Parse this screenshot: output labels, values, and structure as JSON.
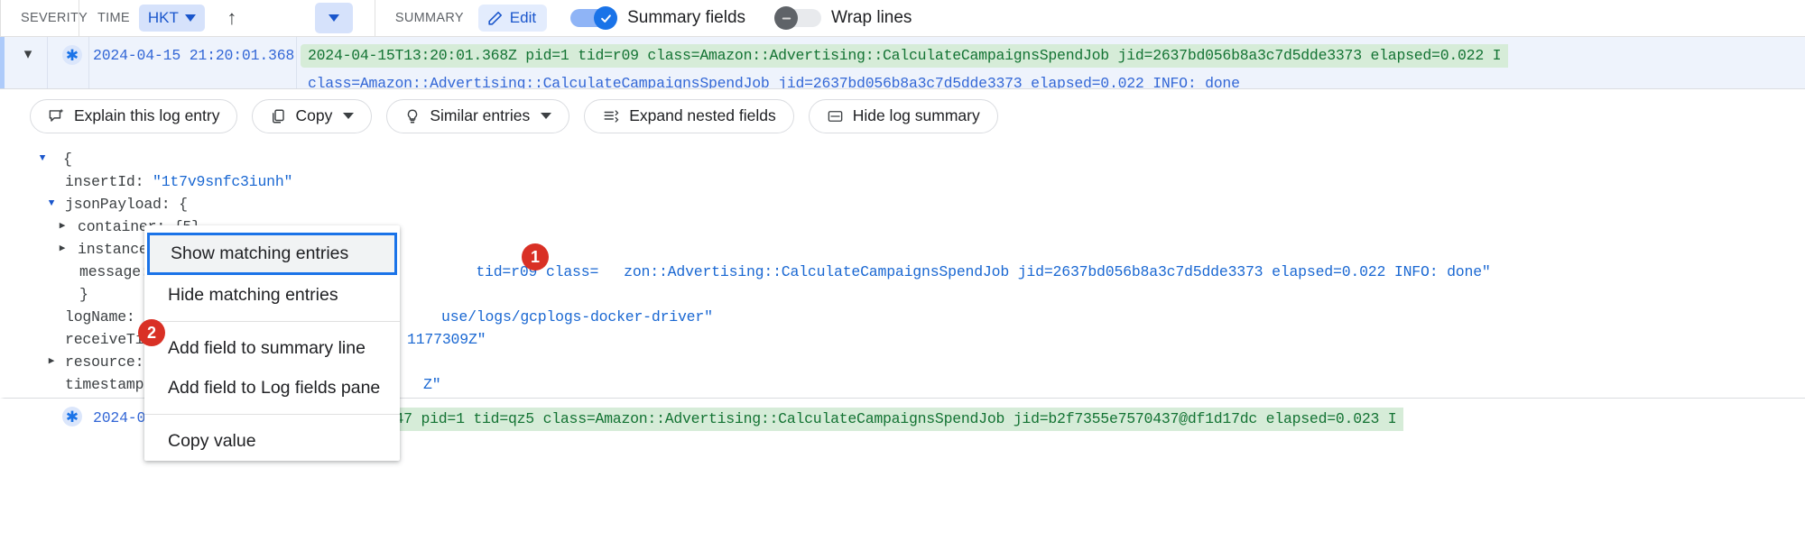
{
  "toolbar": {
    "severity_label": "SEVERITY",
    "time_label": "TIME",
    "timezone_chip": "HKT",
    "sort_ascending_icon": "arrow-up-icon",
    "time_dropdown_icon": "chevron-down-icon",
    "summary_label": "SUMMARY",
    "edit_label": "Edit",
    "edit_icon": "pencil-icon",
    "summary_fields_label": "Summary fields",
    "summary_fields_on": true,
    "wrap_lines_label": "Wrap lines",
    "wrap_lines_on": false
  },
  "log_entry": {
    "expand_icon": "chevron-down-icon",
    "severity_icon": "default-severity-icon",
    "timestamp": "2024-04-15 21:20:01.368",
    "summary_line_1": "2024-04-15T13:20:01.368Z pid=1 tid=r09 class=Amazon::Advertising::CalculateCampaignsSpendJob jid=2637bd056b8a3c7d5dde3373 elapsed=0.022 I",
    "summary_line_2": "class=Amazon::Advertising::CalculateCampaignsSpendJob jid=2637bd056b8a3c7d5dde3373 elapsed=0.022 INFO: done"
  },
  "actions": [
    {
      "label": "Explain this log entry",
      "icon": "sparkle-chat-icon",
      "has_caret": false
    },
    {
      "label": "Copy",
      "icon": "copy-icon",
      "has_caret": true
    },
    {
      "label": "Similar entries",
      "icon": "lightbulb-icon",
      "has_caret": true
    },
    {
      "label": "Expand nested fields",
      "icon": "expand-rows-icon",
      "has_caret": false
    },
    {
      "label": "Hide log summary",
      "icon": "hide-summary-icon",
      "has_caret": false
    }
  ],
  "json_tree": [
    {
      "indent": 0,
      "toggle": "down",
      "key": "",
      "sep": "",
      "value": "{",
      "type": "punct"
    },
    {
      "indent": 1,
      "toggle": "none",
      "key": "insertId",
      "sep": ": ",
      "value": "\"1t7v9snfc3iunh\"",
      "type": "string"
    },
    {
      "indent": 1,
      "toggle": "down",
      "key": "jsonPayload",
      "sep": ": ",
      "value": "{",
      "type": "punct"
    },
    {
      "indent": 2,
      "toggle": "right",
      "key": "container",
      "sep": ": ",
      "value": "{5}",
      "type": "obj"
    },
    {
      "indent": 2,
      "toggle": "right",
      "key": "instance",
      "sep": ": ",
      "value": "",
      "type": "obj"
    },
    {
      "indent": 2,
      "toggle": "none",
      "key": "message",
      "sep": ": ",
      "value": "",
      "type": "string"
    },
    {
      "indent": 2,
      "toggle": "none",
      "key": "",
      "sep": "",
      "value": "}",
      "type": "punct"
    },
    {
      "indent": 1,
      "toggle": "none",
      "key": "logName",
      "sep": ": ",
      "value": "\"",
      "type": "string"
    },
    {
      "indent": 1,
      "toggle": "none",
      "key": "receiveTim",
      "sep": "",
      "value": "",
      "type": "string"
    },
    {
      "indent": 1,
      "toggle": "right",
      "key": "resource",
      "sep": ":",
      "value": "",
      "type": "obj"
    },
    {
      "indent": 1,
      "toggle": "none",
      "key": "timestamp",
      "sep": ": ",
      "value": "",
      "type": "string"
    },
    {
      "indent": 1,
      "toggle": "none",
      "key": "",
      "sep": "",
      "value": "}",
      "type": "punct"
    }
  ],
  "json_overflow": {
    "message_tail": "tid=r09 class=",
    "message_tail_2": "zon::Advertising::CalculateCampaignsSpendJob jid=2637bd056b8a3c7d5dde3373 elapsed=0.022 INFO: done\"",
    "logname_tail": "use/logs/gcplogs-docker-driver\"",
    "receivetime_tail": "1177309Z\"",
    "timestamp_tail": "Z\""
  },
  "context_menu": {
    "items": [
      {
        "label": "Show matching entries",
        "focused": true
      },
      {
        "label": "Hide matching entries",
        "focused": false
      },
      {
        "label": "Add field to summary line",
        "focused": false
      },
      {
        "label": "Add field to Log fields pane",
        "focused": false
      },
      {
        "label": "Copy value",
        "focused": false
      }
    ]
  },
  "callouts": [
    {
      "number": "1"
    },
    {
      "number": "2"
    }
  ],
  "bottom_row": {
    "severity_icon": "default-severity-icon",
    "timestamp": "2024-04-",
    "summary": "3:20:01.3747 pid=1 tid=qz5 class=Amazon::Advertising::CalculateCampaignsSpendJob jid=b2f7355e7570437@df1d17dc elapsed=0.023 I"
  },
  "colors": {
    "accent": "#1a73e8",
    "row_highlight": "#eef3fc",
    "summary_green_bg": "#d6ecd8",
    "summary_green_fg": "#137333",
    "callout_red": "#d93025"
  }
}
